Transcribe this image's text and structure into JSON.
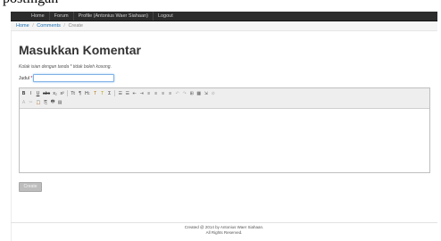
{
  "caption": "postingan",
  "navbar": {
    "items": [
      "Home",
      "Forum",
      "Profile (Antonius Waer Siahaan)",
      "Logout"
    ]
  },
  "breadcrumb": {
    "home": "Home",
    "separator": "/",
    "comments": "Comments",
    "current": "Create"
  },
  "form": {
    "title": "Masukkan Komentar",
    "note": "Kolak isian dengan tanda * tidak boleh kosong.",
    "judul_label": "Judul",
    "required_mark": "*",
    "judul_value": "",
    "submit_label": "Create"
  },
  "toolbar": {
    "row1": [
      "B",
      "I",
      "U",
      "abc",
      "x₂",
      "x²",
      "Tt",
      "¶",
      "H↕",
      "T",
      "T",
      "Σ",
      "☰",
      "☰",
      "⇤",
      "⇥",
      "≡",
      "≡",
      "≡",
      "≡",
      "↶",
      "↷",
      "⊞",
      "▦",
      "⇲",
      "⊘"
    ],
    "row2": [
      "A",
      "✂",
      "📋",
      "⎘",
      "🖶",
      "▤"
    ]
  },
  "footer": {
    "line1": "Created @ 2014 by Antonius Waer Siahaan.",
    "line2": "All Rights Reserved."
  }
}
